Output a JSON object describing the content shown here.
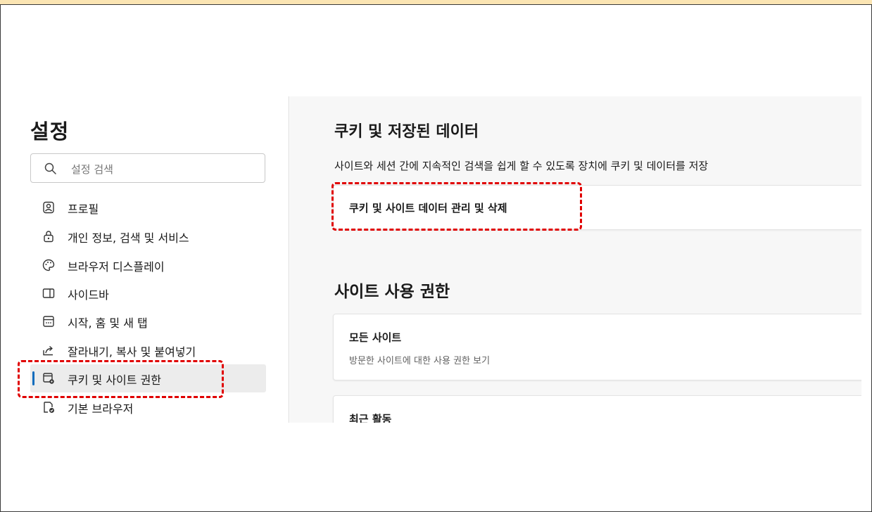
{
  "sidebar": {
    "title": "설정",
    "search_placeholder": "설정 검색",
    "items": [
      {
        "label": "프로필",
        "icon": "profile-icon"
      },
      {
        "label": "개인 정보, 검색 및 서비스",
        "icon": "lock-icon"
      },
      {
        "label": "브라우저 디스플레이",
        "icon": "palette-icon"
      },
      {
        "label": "사이드바",
        "icon": "sidebar-icon"
      },
      {
        "label": "시작, 홈 및 새 탭",
        "icon": "home-tab-icon"
      },
      {
        "label": "잘라내기, 복사 및 붙여넣기",
        "icon": "share-icon"
      },
      {
        "label": "쿠키 및 사이트 권한",
        "icon": "cookie-site-icon",
        "active": true
      },
      {
        "label": "기본 브라우저",
        "icon": "default-browser-icon"
      }
    ]
  },
  "main": {
    "cookies_section": {
      "title": "쿠키 및 저장된 데이터",
      "description": "사이트와 세션 간에 지속적인 검색을 쉽게 할 수 있도록 장치에 쿠키 및 데이터를 저장",
      "card_label": "쿠키 및 사이트 데이터 관리 및 삭제"
    },
    "permissions_section": {
      "title": "사이트 사용 권한",
      "all_sites_title": "모든 사이트",
      "all_sites_subtitle": "방문한 사이트에 대한 사용 권한 보기",
      "recent_activity_title": "최근 활동"
    }
  },
  "colors": {
    "accent": "#0f6cbd",
    "highlight": "#e00000",
    "top_strip": "#fbe5b3"
  }
}
